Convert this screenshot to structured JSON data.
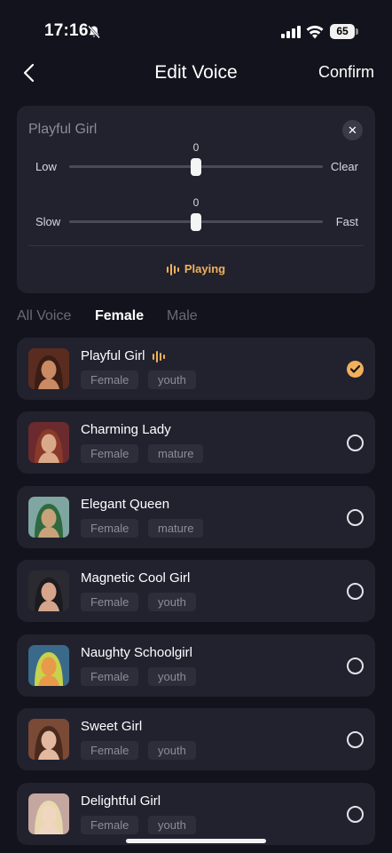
{
  "status_bar": {
    "time": "17:16",
    "battery": "65"
  },
  "header": {
    "title": "Edit Voice",
    "confirm_label": "Confirm"
  },
  "preview": {
    "voice_name": "Playful Girl",
    "pitch": {
      "value": "0",
      "min_label": "Low",
      "max_label": "Clear",
      "level": 0.5
    },
    "speed": {
      "value": "0",
      "min_label": "Slow",
      "max_label": "Fast",
      "level": 0.5
    },
    "playing_label": "Playing"
  },
  "tabs": [
    {
      "label": "All Voice",
      "active": false
    },
    {
      "label": "Female",
      "active": true
    },
    {
      "label": "Male",
      "active": false
    }
  ],
  "voices": [
    {
      "name": "Playful Girl",
      "tags": [
        "Female",
        "youth"
      ],
      "selected": true,
      "playing": true,
      "avatar_colors": [
        "#5a2c1f",
        "#c98a64",
        "#3b1d16"
      ]
    },
    {
      "name": "Charming Lady",
      "tags": [
        "Female",
        "mature"
      ],
      "selected": false,
      "playing": false,
      "avatar_colors": [
        "#6b2a2e",
        "#d9a98a",
        "#8a3a2a"
      ]
    },
    {
      "name": "Elegant Queen",
      "tags": [
        "Female",
        "mature"
      ],
      "selected": false,
      "playing": false,
      "avatar_colors": [
        "#7fa6a0",
        "#c8a27a",
        "#2f6a3f"
      ]
    },
    {
      "name": "Magnetic Cool Girl",
      "tags": [
        "Female",
        "youth"
      ],
      "selected": false,
      "playing": false,
      "avatar_colors": [
        "#2a2a30",
        "#d4a58a",
        "#1b1b20"
      ]
    },
    {
      "name": "Naughty Schoolgirl",
      "tags": [
        "Female",
        "youth"
      ],
      "selected": false,
      "playing": false,
      "avatar_colors": [
        "#3a6a8a",
        "#e89a4a",
        "#c8d24a"
      ]
    },
    {
      "name": "Sweet Girl",
      "tags": [
        "Female",
        "youth"
      ],
      "selected": false,
      "playing": false,
      "avatar_colors": [
        "#7a4a36",
        "#e2b8a0",
        "#4a2a1e"
      ]
    },
    {
      "name": "Delightful Girl",
      "tags": [
        "Female",
        "youth"
      ],
      "selected": false,
      "playing": false,
      "avatar_colors": [
        "#c4a7a0",
        "#f0d6c0",
        "#e8d8b0"
      ]
    }
  ],
  "colors": {
    "accent": "#f1b15a",
    "background": "#13131d",
    "card": "#22222f"
  },
  "icons": [
    "bell-slash-icon",
    "signal-icon",
    "wifi-icon",
    "battery-icon",
    "chevron-left-icon",
    "close-icon",
    "equalizer-icon",
    "checkmark-icon",
    "radio-empty-icon"
  ]
}
